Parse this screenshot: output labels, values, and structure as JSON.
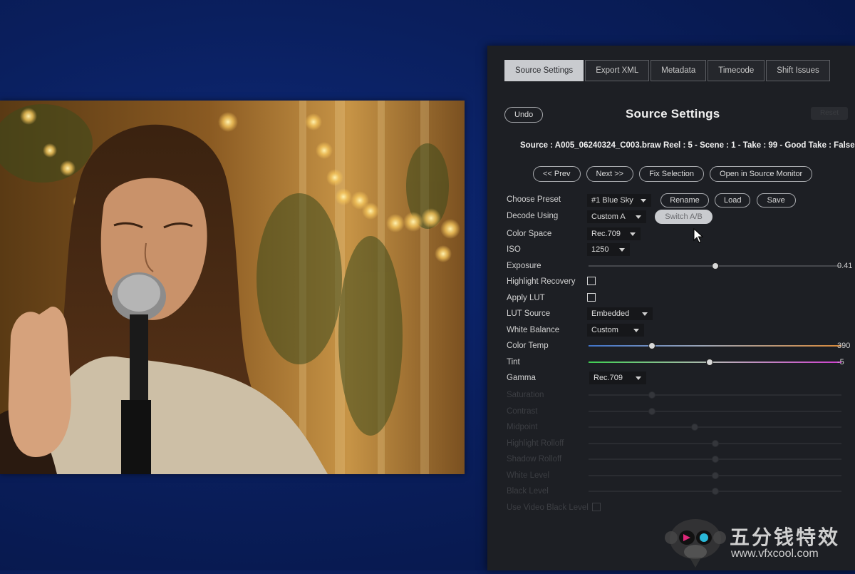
{
  "tabs": [
    {
      "label": "Source Settings",
      "active": true
    },
    {
      "label": "Export XML",
      "active": false
    },
    {
      "label": "Metadata",
      "active": false
    },
    {
      "label": "Timecode",
      "active": false
    },
    {
      "label": "Shift Issues",
      "active": false
    }
  ],
  "header": {
    "undo_label": "Undo",
    "title": "Source Settings",
    "right_button": "Reset"
  },
  "source_info": "Source : A005_06240324_C003.braw   Reel : 5 - Scene : 1 - Take : 99 - Good Take : False",
  "nav_buttons": [
    "<< Prev",
    "Next >>",
    "Fix Selection",
    "Open in Source Monitor"
  ],
  "preset": {
    "label": "Choose Preset",
    "value": "#1 Blue Sky",
    "buttons": [
      "Rename",
      "Load",
      "Save"
    ]
  },
  "decode": {
    "label": "Decode Using",
    "value": "Custom A",
    "button": "Switch A/B"
  },
  "color_space": {
    "label": "Color Space",
    "value": "Rec.709"
  },
  "iso": {
    "label": "ISO",
    "value": "1250"
  },
  "exposure": {
    "label": "Exposure",
    "value": "0.41",
    "level": 0.5
  },
  "highlight_recovery": {
    "label": "Highlight Recovery",
    "checked": false
  },
  "apply_lut": {
    "label": "Apply LUT",
    "checked": false
  },
  "lut_source": {
    "label": "LUT Source",
    "value": "Embedded"
  },
  "white_balance": {
    "label": "White Balance",
    "value": "Custom"
  },
  "color_temp": {
    "label": "Color Temp",
    "value": "390",
    "level": 0.25
  },
  "tint": {
    "label": "Tint",
    "value": "-5",
    "level": 0.48
  },
  "gamma": {
    "label": "Gamma",
    "value": "Rec.709"
  },
  "disabled": {
    "saturation": "Saturation",
    "contrast": "Contrast",
    "midpoint": "Midpoint",
    "highlight_rolloff": "Highlight Rolloff",
    "shadow_rolloff": "Shadow Rolloff",
    "white_level": "White Level",
    "black_level": "Black Level",
    "video_black": "Use Video Black Level"
  },
  "watermark": {
    "text": "五分钱特效",
    "url": "www.vfxcool.com"
  },
  "colors": {
    "background": "#0a1f5e",
    "panel": "#1d1f24",
    "active_tab": "#c9cbcf"
  }
}
